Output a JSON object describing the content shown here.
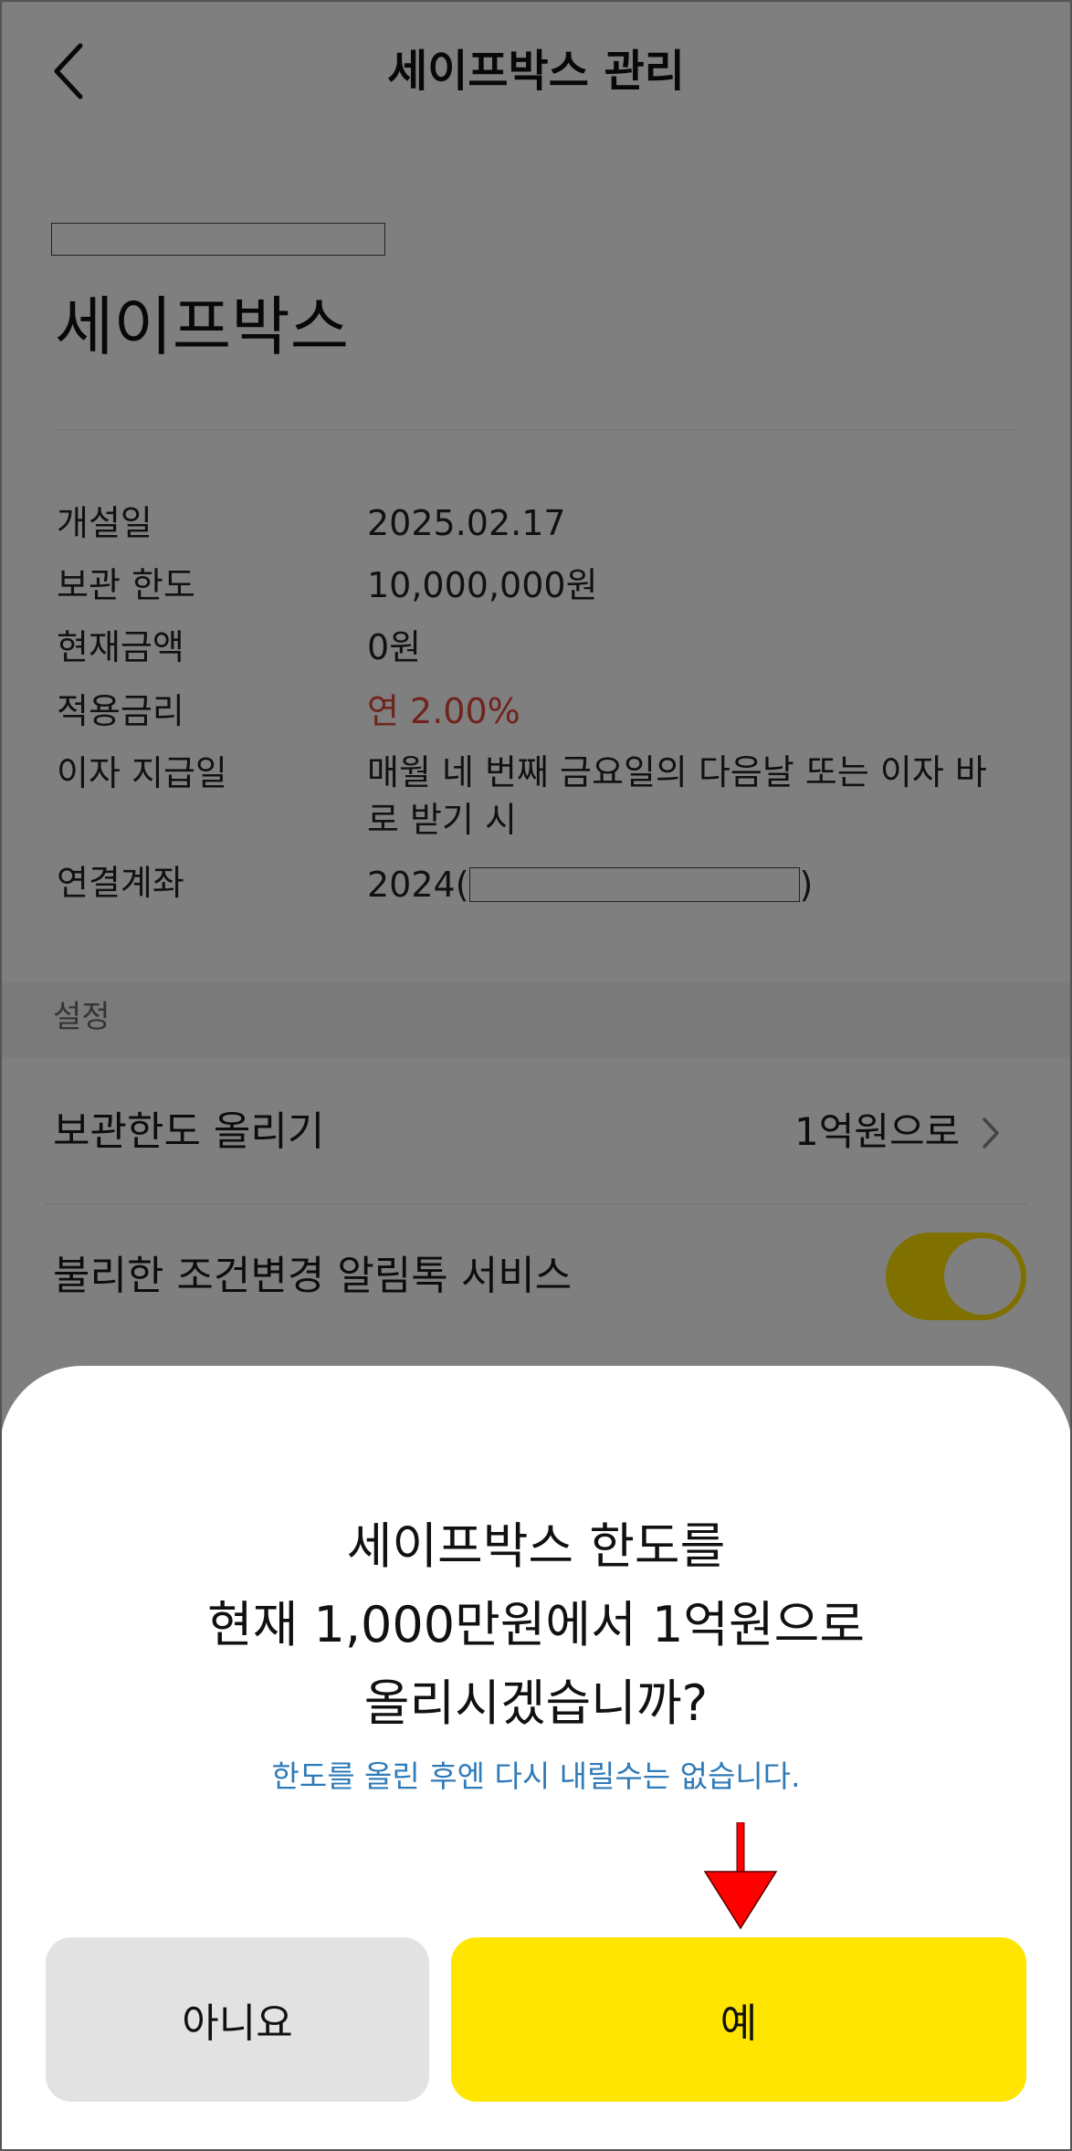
{
  "header": {
    "title": "세이프박스 관리"
  },
  "account": {
    "product_title": "세이프박스",
    "details": [
      {
        "label": "개설일",
        "value": "2025.02.17"
      },
      {
        "label": "보관 한도",
        "value": "10,000,000원"
      },
      {
        "label": "현재금액",
        "value": "0원"
      },
      {
        "label": "적용금리",
        "value": "연 2.00%"
      },
      {
        "label": "이자 지급일",
        "value": "매월 네 번째 금요일의 다음날 또는 이자 바로 받기 시"
      },
      {
        "label": "연결계좌",
        "value_prefix": "2024(",
        "value_suffix": ")"
      }
    ]
  },
  "settings": {
    "section_label": "설정",
    "raise_limit": {
      "label": "보관한도 올리기",
      "value": "1억원으로"
    },
    "alert_service": {
      "label": "불리한 조건변경 알림톡 서비스",
      "enabled": true
    }
  },
  "dialog": {
    "lines": [
      "세이프박스 한도를",
      "현재 1,000만원에서 1억원으로",
      "올리시겠습니까?"
    ],
    "note": "한도를 올린 후엔 다시 내릴수는 없습니다.",
    "no_label": "아니요",
    "yes_label": "예"
  },
  "colors": {
    "accent_yellow": "#ffe500",
    "rate_red": "#e0483a",
    "note_blue": "#2f7ab8",
    "annotation_arrow": "#ff0000"
  },
  "icons": {
    "back": "chevron-left-icon",
    "row_chevron": "chevron-right-icon",
    "annotation": "down-arrow-icon"
  }
}
